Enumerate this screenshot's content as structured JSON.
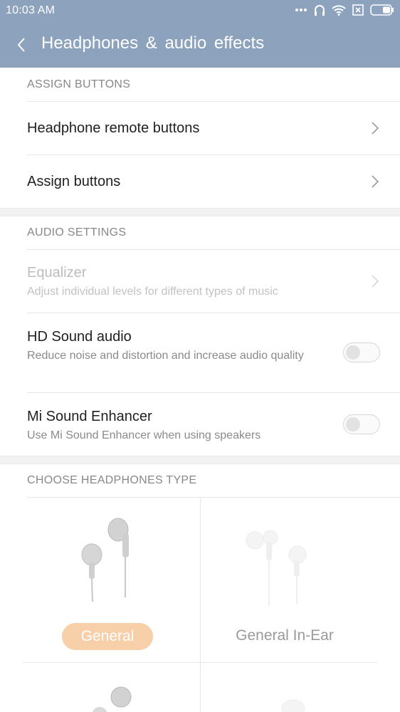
{
  "status_bar": {
    "time": "10:03  AM",
    "icons": [
      "more-dots-icon",
      "headphones-icon",
      "wifi-icon",
      "sim-off-icon",
      "battery-icon"
    ]
  },
  "app_bar": {
    "title": "Headphones  &  audio  effects"
  },
  "sections": {
    "assign": {
      "header": "ASSIGN BUTTONS",
      "items": [
        {
          "label": "Headphone remote buttons"
        },
        {
          "label": "Assign buttons"
        }
      ]
    },
    "audio": {
      "header": "AUDIO SETTINGS",
      "equalizer": {
        "label": "Equalizer",
        "sub": "Adjust individual levels for different types of music",
        "enabled": false
      },
      "hd_sound": {
        "label": "HD Sound audio",
        "sub": "Reduce noise and distortion and increase audio quality",
        "on": false
      },
      "mi_sound": {
        "label": "Mi Sound Enhancer",
        "sub": "Use Mi Sound Enhancer when using speakers",
        "on": false
      }
    },
    "headphones": {
      "header": "CHOOSE HEADPHONES TYPE",
      "types": [
        {
          "label": "General",
          "selected": true
        },
        {
          "label": "General In-Ear",
          "selected": false
        }
      ]
    }
  },
  "colors": {
    "app_bar": "#8ca2bd",
    "selected_pill": "#f7cfa9",
    "divider": "#e6e6e6"
  }
}
